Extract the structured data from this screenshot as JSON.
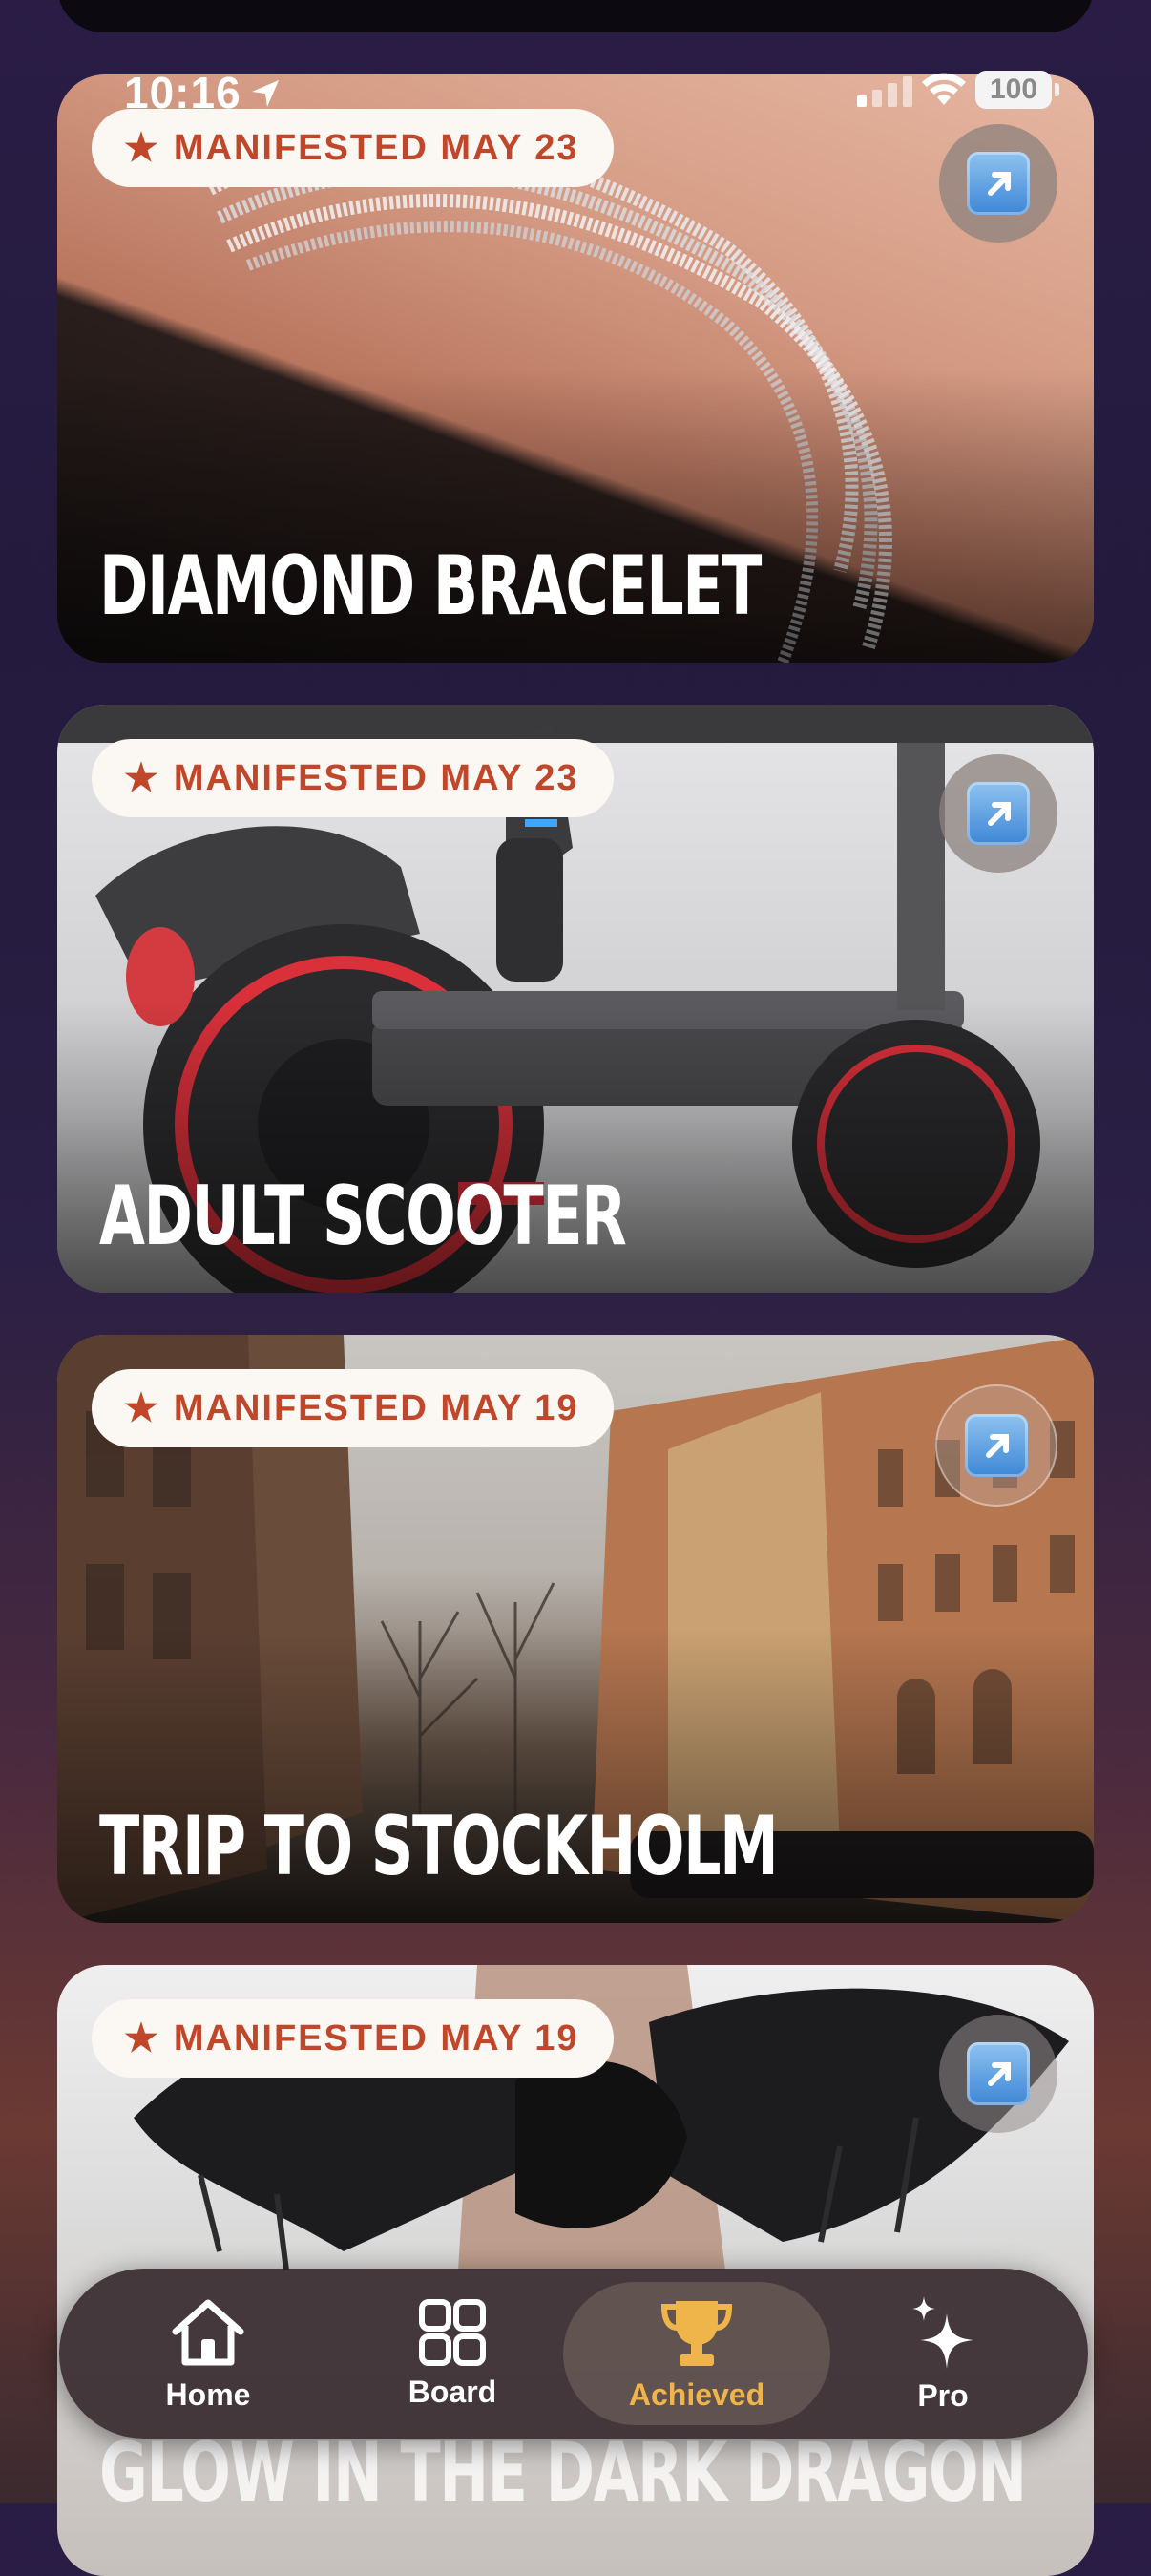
{
  "status_bar": {
    "time": "10:16",
    "battery": "100"
  },
  "cards": [
    {
      "badge": "MANIFESTED MAY 23",
      "title": "DIAMOND BRACELET"
    },
    {
      "badge": "MANIFESTED MAY 23",
      "title": "ADULT SCOOTER"
    },
    {
      "badge": "MANIFESTED MAY 19",
      "title": "TRIP TO STOCKHOLM"
    },
    {
      "badge": "MANIFESTED MAY 19",
      "title": "GLOW IN THE DARK DRAGON"
    }
  ],
  "tabs": [
    {
      "label": "Home",
      "icon": "house-icon"
    },
    {
      "label": "Board",
      "icon": "grid-icon"
    },
    {
      "label": "Achieved",
      "icon": "trophy-icon",
      "active": true
    },
    {
      "label": "Pro",
      "icon": "sparkles-icon"
    }
  ],
  "colors": {
    "badge_text": "#c0472a",
    "active_tab": "#f0b54a",
    "background": "#2a1d45"
  }
}
